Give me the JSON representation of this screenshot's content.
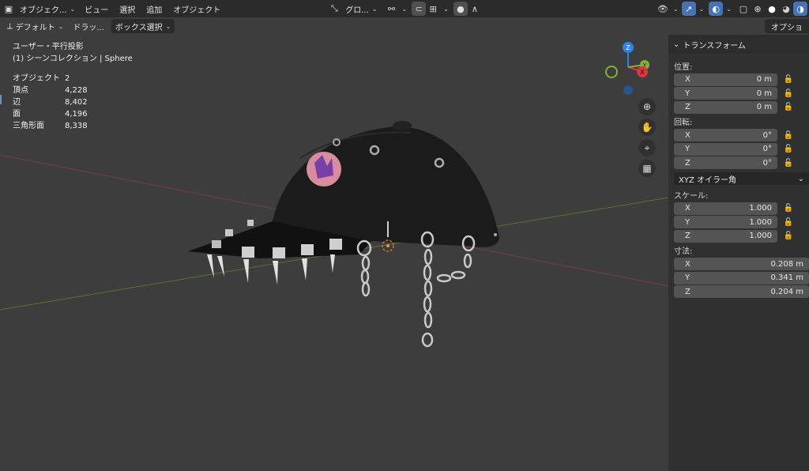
{
  "header": {
    "mode_label": "オブジェク...",
    "menu": [
      "ビュー",
      "選択",
      "追加",
      "オブジェクト"
    ],
    "transform_orientation": "グロ...",
    "icons": [
      "editor-type-icon",
      "orientation-icon",
      "pivot-icon",
      "snap-icon",
      "snap-target-icon",
      "proportional-icon",
      "falloff-icon",
      "visibility-icon",
      "gizmo-icon",
      "overlay-icon",
      "xray-icon",
      "shading-wire-icon",
      "shading-solid-icon",
      "shading-material-icon",
      "shading-rendered-icon"
    ]
  },
  "toolbar2": {
    "orientation_label": "デフォルト",
    "drag_label": "ドラッ...",
    "select_label": "ボックス選択",
    "options_label": "オプショ"
  },
  "viewport": {
    "view_name": "ユーザー・平行投影",
    "collection_label": "(1) シーンコレクション | Sphere",
    "stats": [
      {
        "key": "オブジェクト",
        "value": "2"
      },
      {
        "key": "頂点",
        "value": "4,228"
      },
      {
        "key": "辺",
        "value": "8,402"
      },
      {
        "key": "面",
        "value": "4,196"
      },
      {
        "key": "三角形面",
        "value": "8,338"
      }
    ],
    "gizmo_axes": {
      "x": "X",
      "y": "Y",
      "z": "Z"
    },
    "colors": {
      "x_axis": "#d9363e",
      "y_axis": "#7fb236",
      "z_axis": "#2f83e4",
      "x_line": "#8a3a40",
      "y_line": "#5a7a2a",
      "background": "#3d3d3d"
    }
  },
  "npanel": {
    "title": "トランスフォーム",
    "location_label": "位置:",
    "location": [
      {
        "axis": "X",
        "value": "0 m"
      },
      {
        "axis": "Y",
        "value": "0 m"
      },
      {
        "axis": "Z",
        "value": "0 m"
      }
    ],
    "rotation_label": "回転:",
    "rotation": [
      {
        "axis": "X",
        "value": "0°"
      },
      {
        "axis": "Y",
        "value": "0°"
      },
      {
        "axis": "Z",
        "value": "0°"
      }
    ],
    "rotation_mode": "XYZ オイラー角",
    "scale_label": "スケール:",
    "scale": [
      {
        "axis": "X",
        "value": "1.000"
      },
      {
        "axis": "Y",
        "value": "1.000"
      },
      {
        "axis": "Z",
        "value": "1.000"
      }
    ],
    "dimensions_label": "寸法:",
    "dimensions": [
      {
        "axis": "X",
        "value": "0.208 m"
      },
      {
        "axis": "Y",
        "value": "0.341 m"
      },
      {
        "axis": "Z",
        "value": "0.204 m"
      }
    ]
  }
}
